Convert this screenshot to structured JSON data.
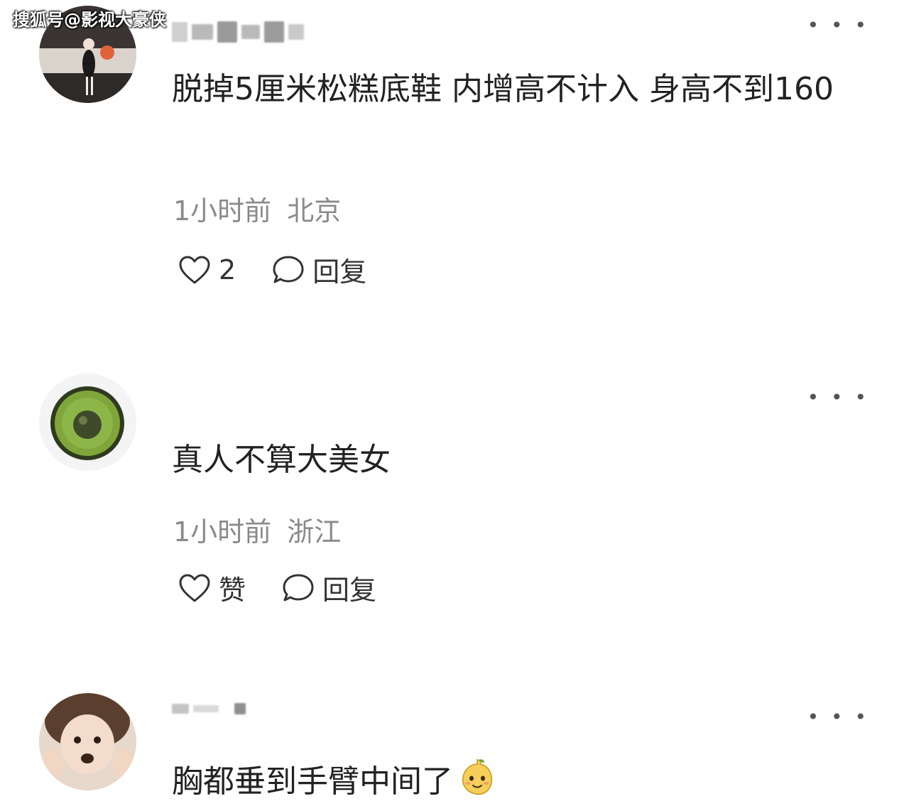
{
  "watermark": "搜狐号@影视大豪侠",
  "comments": [
    {
      "content": "脱掉5厘米松糕底鞋 内增高不计入 身高不到160",
      "time": "1小时前",
      "location": "北京",
      "like_label": "2",
      "reply_label": "回复"
    },
    {
      "content": "真人不算大美女",
      "time": "1小时前",
      "location": "浙江",
      "like_label": "赞",
      "reply_label": "回复"
    },
    {
      "content": "胸都垂到手臂中间了"
    }
  ],
  "more_label": "• • •",
  "icons": {
    "like": "heart-outline-icon",
    "reply": "speech-bubble-icon",
    "more": "more-dots-icon",
    "emoji": "mango-face-emoji"
  },
  "colors": {
    "text": "#222222",
    "meta": "#8a8a8a",
    "icon": "#333333"
  }
}
